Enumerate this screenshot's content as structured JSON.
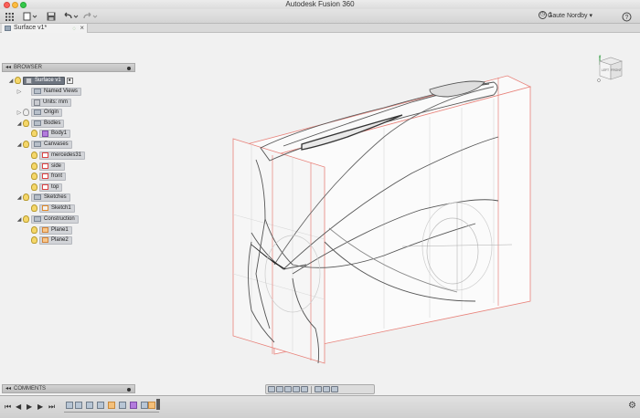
{
  "window": {
    "title": "Autodesk Fusion 360"
  },
  "toolbar": {
    "user_name": "Gaute Nordby",
    "jobs_count": "1",
    "icons": [
      "app-grid-icon",
      "file-icon",
      "save-icon",
      "undo-icon",
      "redo-icon",
      "clock-icon"
    ]
  },
  "tab": {
    "title": "Surface v1*"
  },
  "browser": {
    "title": "BROWSER",
    "root": "Surface v1",
    "items": {
      "named_views": "Named Views",
      "units": "Units: mm",
      "origin": "Origin",
      "bodies": "Bodies",
      "body1": "Body1",
      "canvases": "Canvases",
      "canvas1": "mercedes31",
      "canvas2": "side",
      "canvas3": "front",
      "canvas4": "top",
      "sketches": "Sketches",
      "sketch1": "Sketch1",
      "construction": "Construction",
      "plane1": "Plane1",
      "plane2": "Plane2"
    }
  },
  "viewcube": {
    "face_left": "LEFT",
    "face_front": "FRONT",
    "axis": "Z"
  },
  "comments": {
    "title": "COMMENTS"
  },
  "colors": {
    "canvas_border": "#e8827a",
    "accent": "#6e7580"
  }
}
